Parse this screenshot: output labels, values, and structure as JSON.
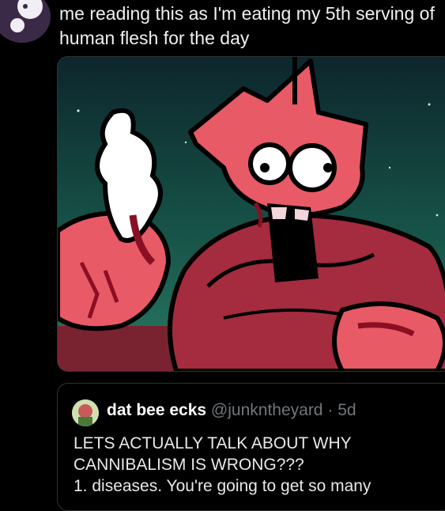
{
  "tweet": {
    "text_line1": "me reading this as I'm eating my 5th serving of",
    "text_line2": "human flesh for the day"
  },
  "media": {
    "sky_top": "#0e2a2f",
    "sky_bottom": "#1f6a5c",
    "floor": "#7a2330",
    "creature_color": "#e85a66",
    "body_color": "#a52b3e",
    "blood_color": "#8a0f22"
  },
  "quote": {
    "author_name": "dat bee ecks",
    "author_handle": "@junkntheyard",
    "separator": "·",
    "time": "5d",
    "line1": "LETS ACTUALLY TALK ABOUT WHY",
    "line2": "CANNIBALISM IS WRONG???",
    "line3": "1. diseases. You're going to get so many"
  }
}
